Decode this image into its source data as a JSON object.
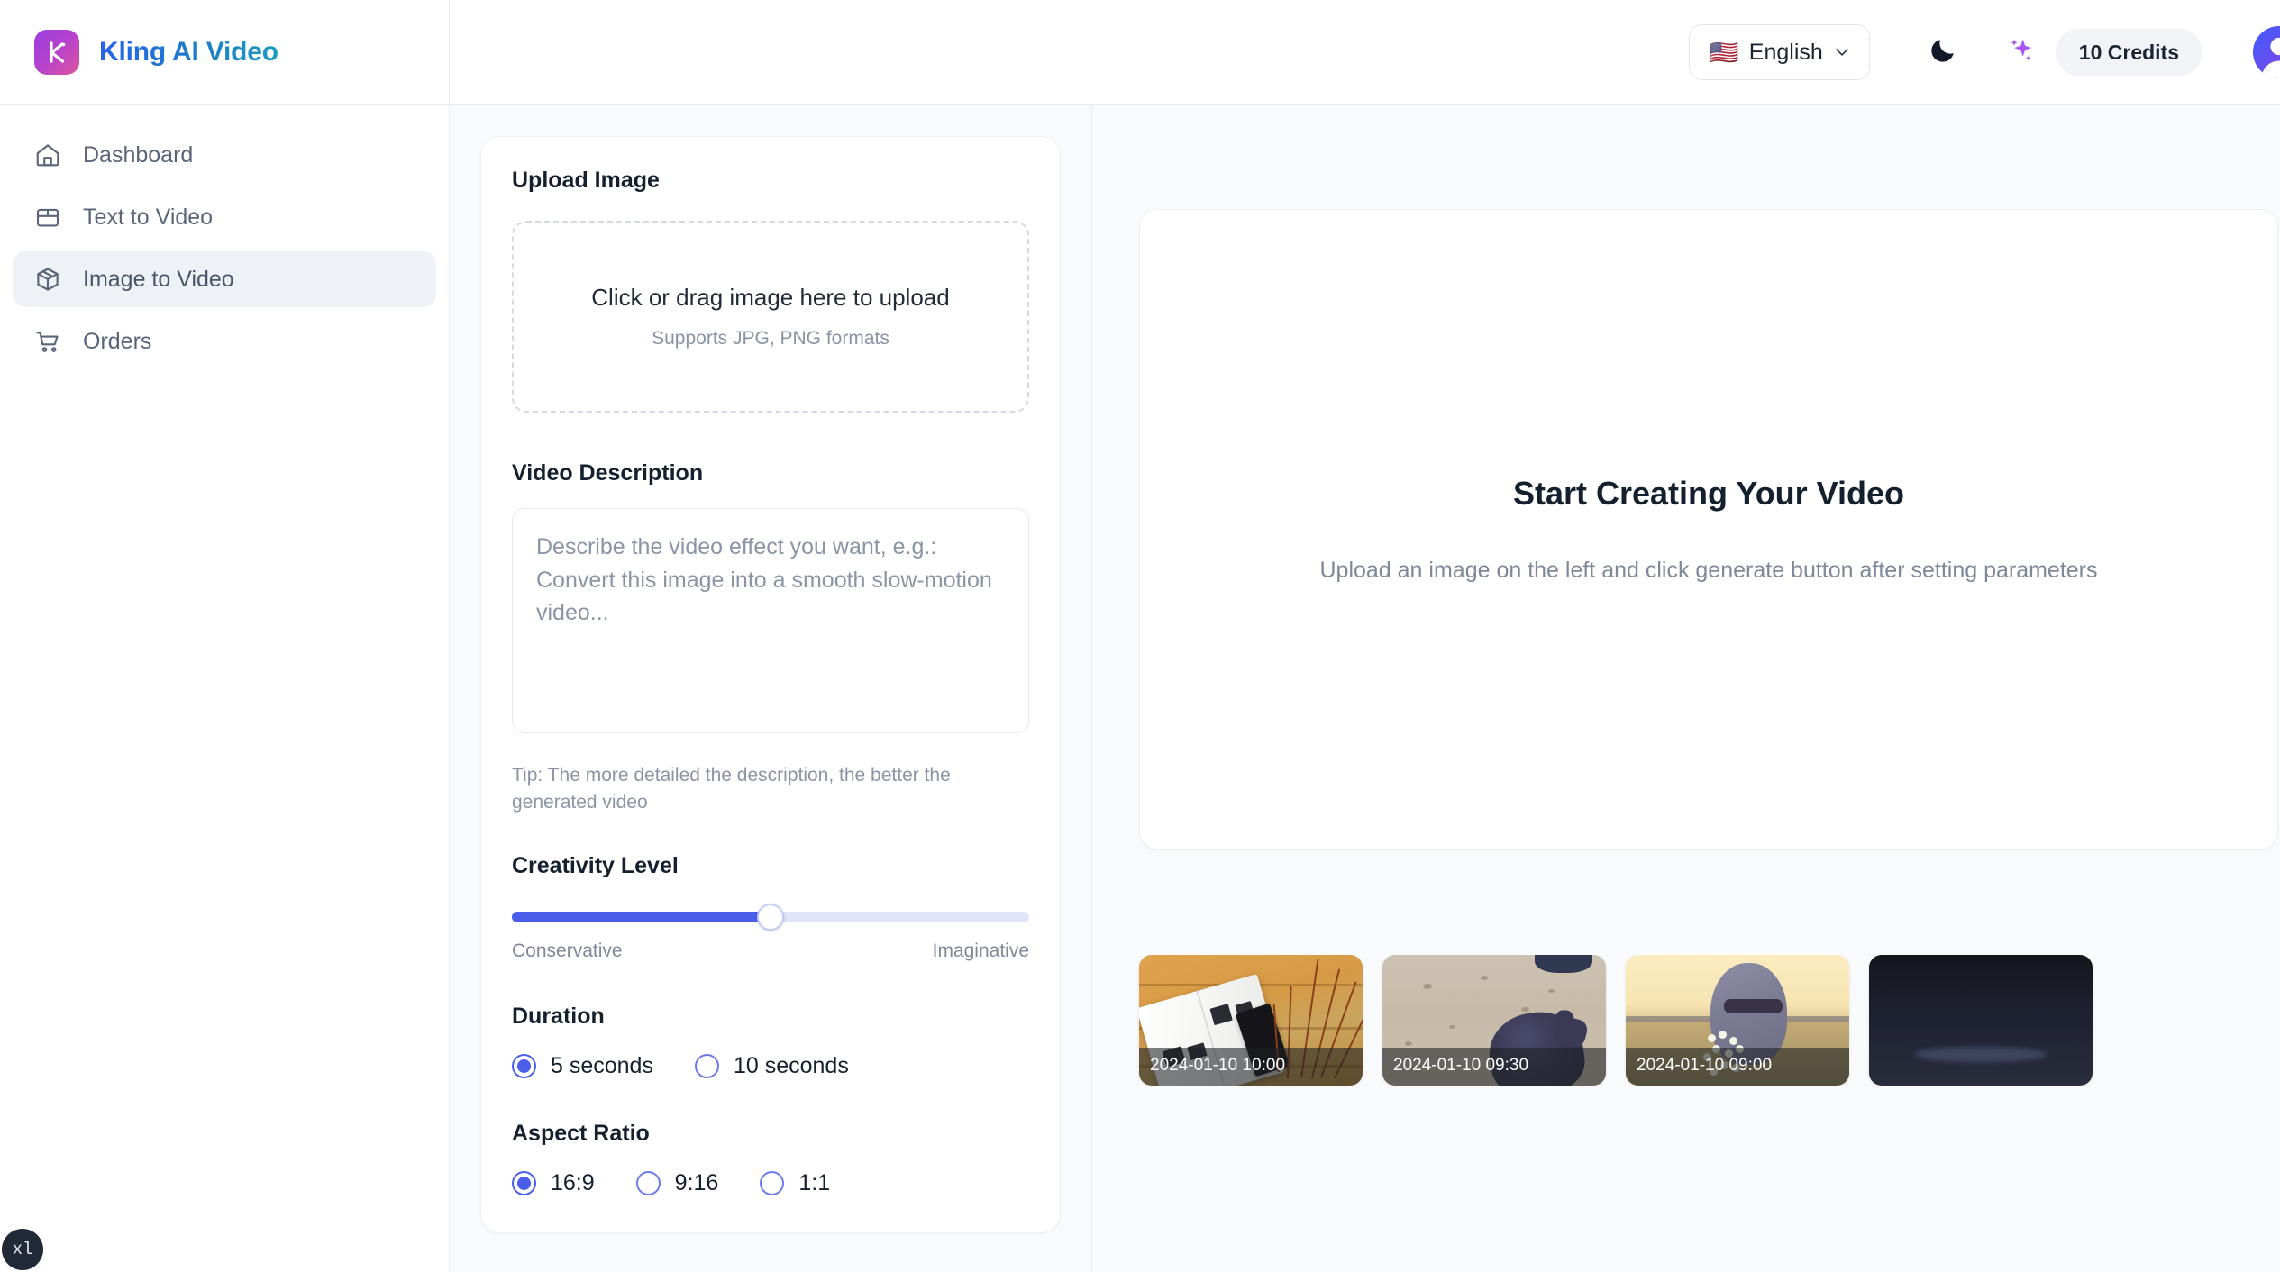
{
  "brand": {
    "title": "Kling AI Video",
    "logo_letter": "K",
    "logo_gradient_from": "#9b3fe0",
    "logo_gradient_to": "#e0559f",
    "title_gradient_from": "#2563eb",
    "title_gradient_to": "#1b9cc0"
  },
  "sidebar": {
    "items": [
      {
        "label": "Dashboard",
        "icon": "home-icon",
        "active": false
      },
      {
        "label": "Text to Video",
        "icon": "package-icon",
        "active": false
      },
      {
        "label": "Image to Video",
        "icon": "box-3d-icon",
        "active": true
      },
      {
        "label": "Orders",
        "icon": "shopping-cart-icon",
        "active": false
      }
    ],
    "active_bg": "#eef1f5"
  },
  "topbar": {
    "language": {
      "flag": "🇺🇸",
      "label": "English",
      "chevron": "chevron-down-icon"
    },
    "theme_toggle_icon": "moon-icon",
    "sparkles_icon": "sparkles-icon",
    "sparkles_color": "#a855f7",
    "credits": "10 Credits",
    "avatar": "user-avatar"
  },
  "form": {
    "upload": {
      "title": "Upload Image",
      "dropzone_main": "Click or drag image here to upload",
      "dropzone_sub": "Supports JPG, PNG formats"
    },
    "description": {
      "label": "Video Description",
      "placeholder": "Describe the video effect you want, e.g.: Convert this image into a smooth slow-motion video...",
      "value": "",
      "tip": "Tip: The more detailed the description, the better the generated video"
    },
    "creativity": {
      "label": "Creativity Level",
      "value": 50,
      "min_label": "Conservative",
      "max_label": "Imaginative",
      "fill_color": "#4a5eea",
      "track_color": "#dfe6fb"
    },
    "duration": {
      "label": "Duration",
      "options": [
        {
          "label": "5 seconds",
          "selected": true
        },
        {
          "label": "10 seconds",
          "selected": false
        }
      ]
    },
    "aspect_ratio": {
      "label": "Aspect Ratio",
      "options": [
        {
          "label": "16:9",
          "selected": true
        },
        {
          "label": "9:16",
          "selected": false
        },
        {
          "label": "1:1",
          "selected": false
        }
      ]
    }
  },
  "preview": {
    "title": "Start Creating Your Video",
    "subtitle": "Upload an image on the left and click generate button after setting parameters"
  },
  "history": {
    "items": [
      {
        "timestamp": "2024-01-10 10:00",
        "thumb": "book-on-wooden-table"
      },
      {
        "timestamp": "2024-01-10 09:30",
        "thumb": "hand-in-sand"
      },
      {
        "timestamp": "2024-01-10 09:00",
        "thumb": "woman-sunglasses-field"
      },
      {
        "timestamp": "",
        "thumb": "dark-scene"
      }
    ]
  },
  "breakpoint_badge": "xl"
}
